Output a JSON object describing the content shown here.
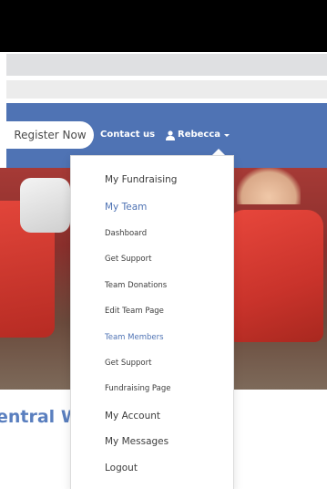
{
  "navbar": {
    "register_label": "Register Now",
    "contact_label": "Contact us",
    "user_label": "Rebecca",
    "bg_color": "#4f73b4"
  },
  "dropdown": {
    "items": [
      {
        "label": "My Fundraising",
        "style": "large"
      },
      {
        "label": "My Team",
        "style": "large",
        "active": true
      },
      {
        "label": "Dashboard",
        "style": "small"
      },
      {
        "label": "Get Support",
        "style": "small"
      },
      {
        "label": "Team Donations",
        "style": "small"
      },
      {
        "label": "Edit Team Page",
        "style": "small"
      },
      {
        "label": "Team Members",
        "style": "small",
        "active": true
      },
      {
        "label": "Get Support",
        "style": "small"
      },
      {
        "label": "Fundraising Page",
        "style": "small"
      },
      {
        "label": "My Account",
        "style": "large"
      },
      {
        "label": "My Messages",
        "style": "large"
      },
      {
        "label": "Logout",
        "style": "large"
      }
    ]
  },
  "page": {
    "heading_partial": "entral W"
  },
  "icons": {
    "user": "user-icon",
    "caret": "chevron-down-icon"
  }
}
